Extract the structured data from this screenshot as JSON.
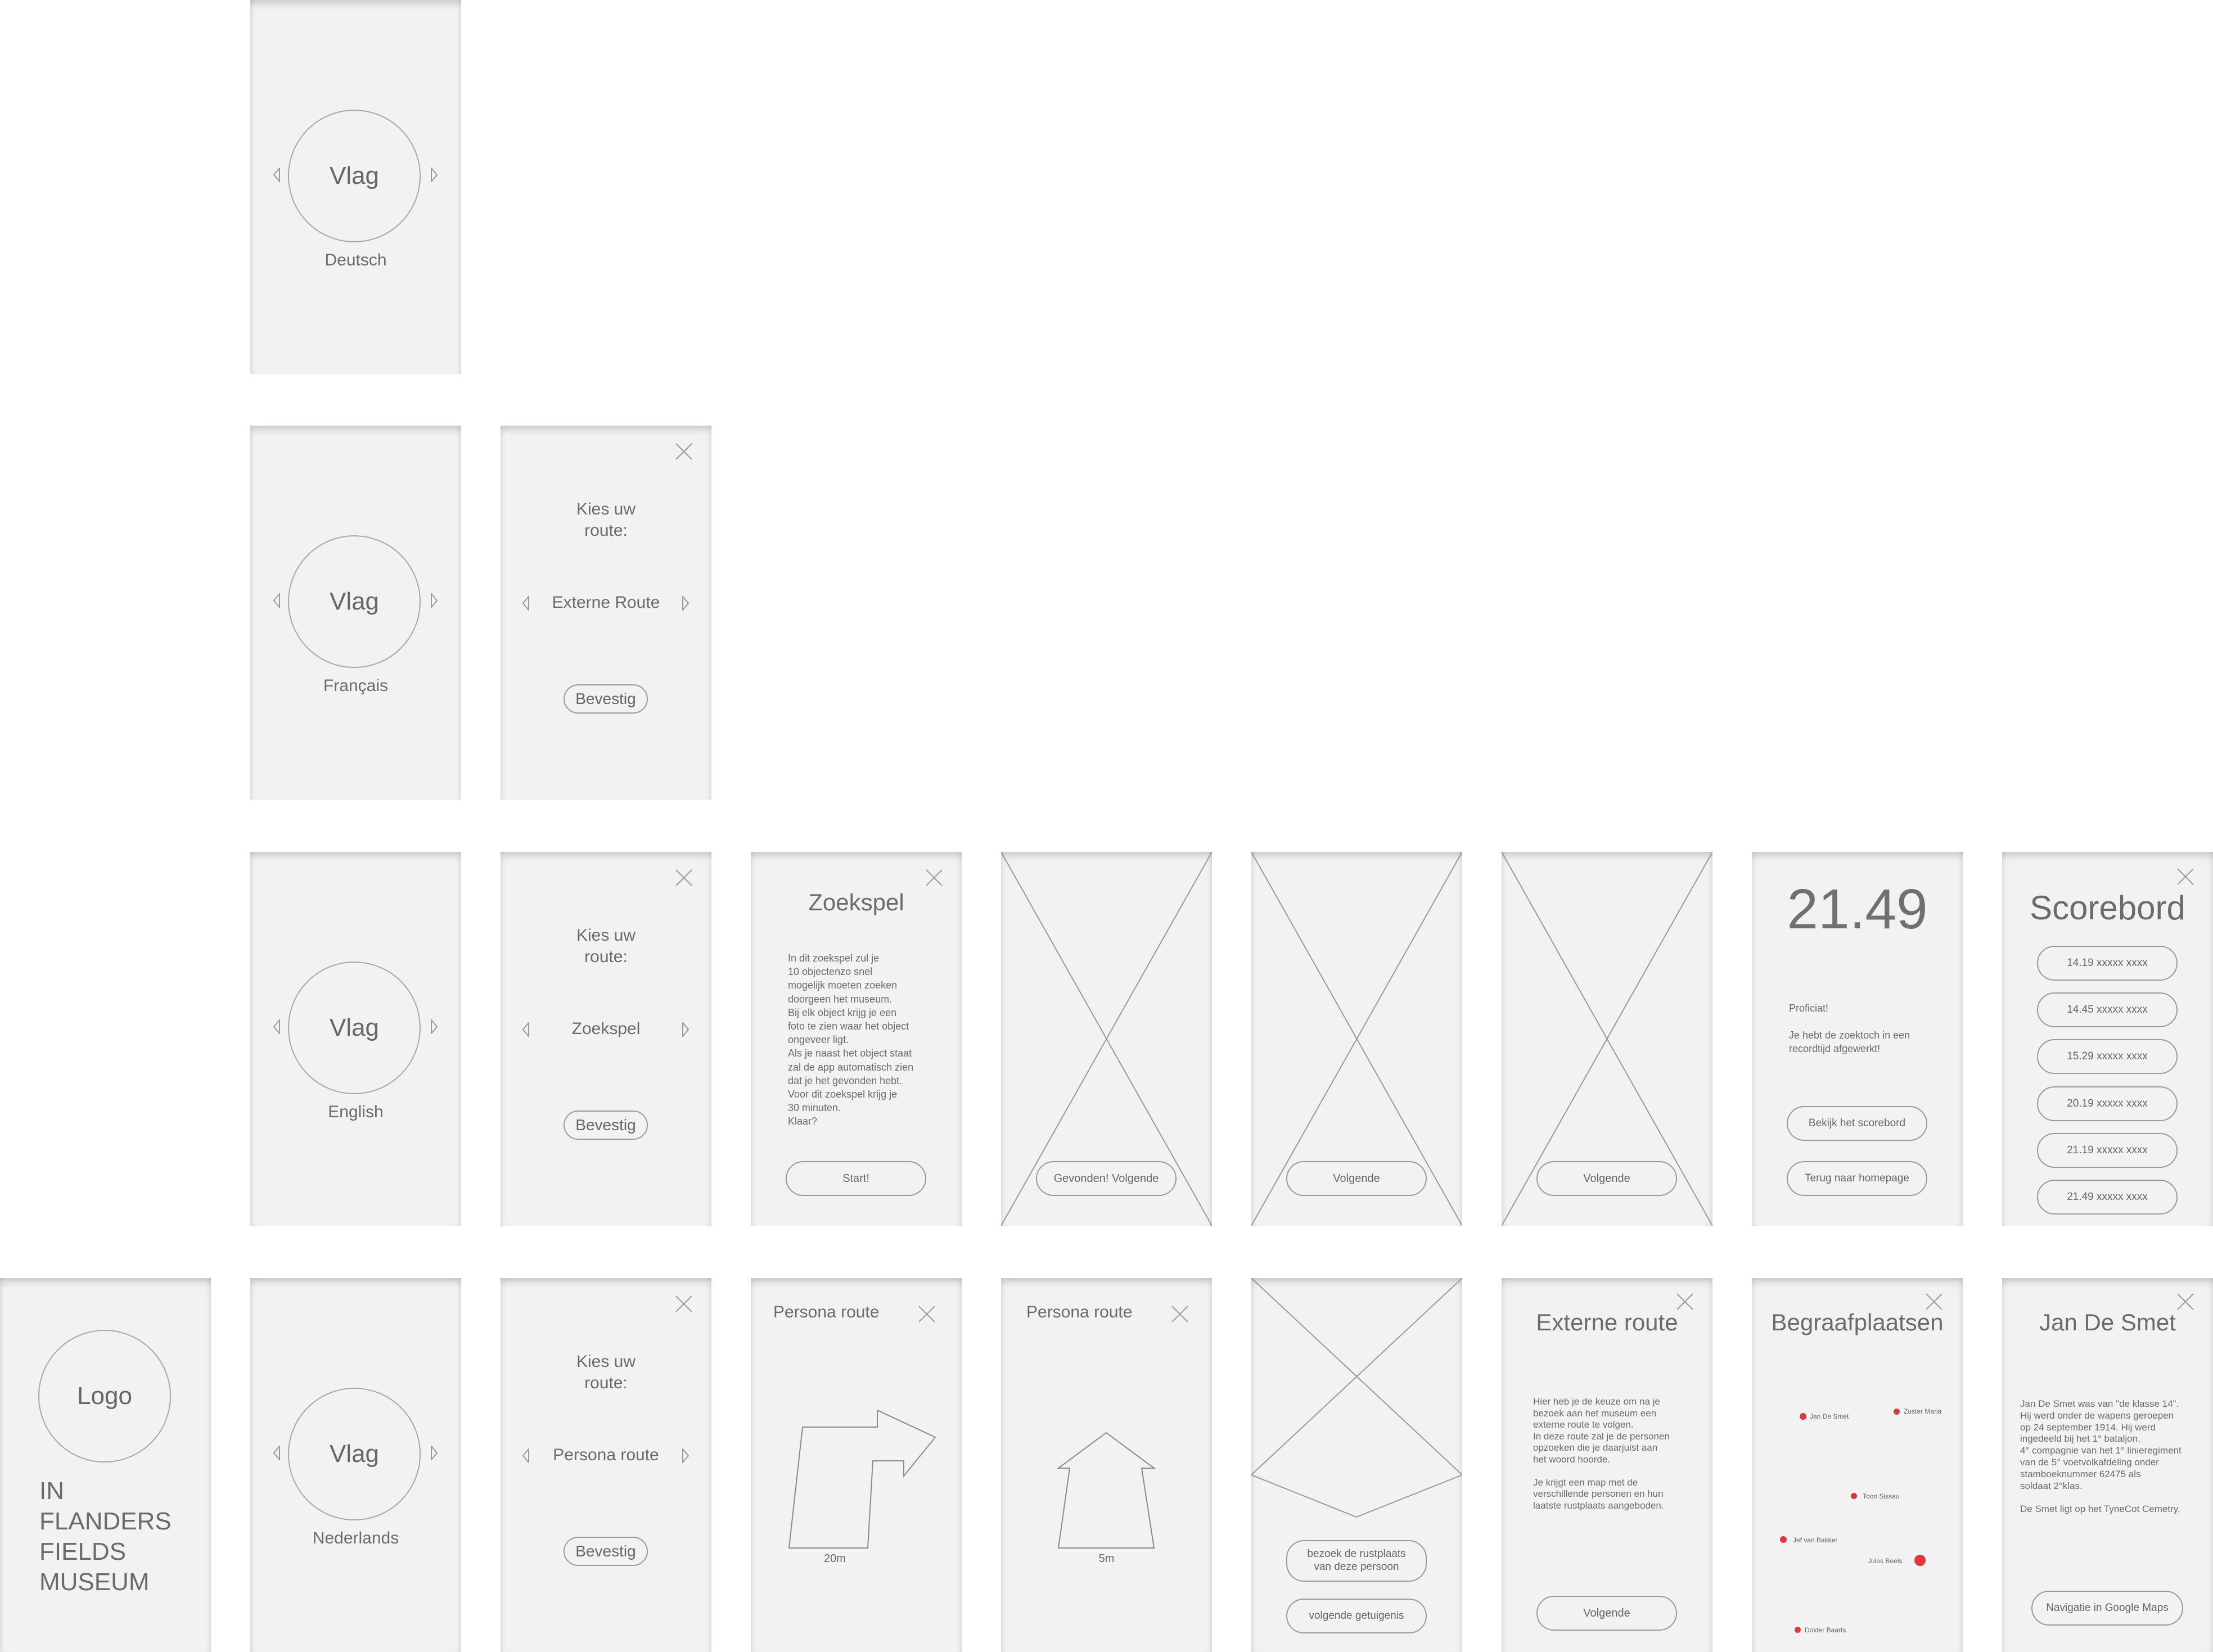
{
  "languages": [
    {
      "circle": "Vlag",
      "label": "Deutsch"
    },
    {
      "circle": "Vlag",
      "label": "Français"
    },
    {
      "circle": "Vlag",
      "label": "English"
    },
    {
      "circle": "Vlag",
      "label": "Nederlands"
    }
  ],
  "route_picker": {
    "title": "Kies uw\nroute:",
    "confirm": "Bevestig",
    "options": [
      "Externe Route",
      "Zoekspel",
      "Persona route"
    ]
  },
  "home": {
    "logo": "Logo",
    "museum_name": "IN\nFLANDERS\nFIELDS\nMUSEUM"
  },
  "zoekspel": {
    "title": "Zoekspel",
    "body": "In dit zoekspel zul je\n10 objectenzo snel\nmogelijk moeten zoeken\ndoorgeen het museum.\nBij elk object krijg je een\nfoto te zien waar het object\nongeveer ligt.\nAls je naast het object staat\nzal de app automatisch zien\ndat je het gevonden hebt.\nVoor dit zoekspel krijg je\n30 minuten.\nKlaar?",
    "start": "Start!"
  },
  "placeholders": {
    "found_next": "Gevonden! Volgende",
    "next_1": "Volgende",
    "next_2": "Volgende"
  },
  "result": {
    "time": "21.49",
    "congrats": "Proficiat!",
    "message": "Je hebt de zoektoch in een\nrecordtijd afgewerkt!",
    "view_scoreboard": "Bekijk het scorebord",
    "back_home": "Terug naar homepage"
  },
  "scoreboard": {
    "title": "Scorebord",
    "entries": [
      "14.19 xxxxx xxxx",
      "14.45 xxxxx xxxx",
      "15.29 xxxxx xxxx",
      "20.19 xxxxx xxxx",
      "21.19 xxxxx xxxx",
      "21.49 xxxxx xxxx"
    ]
  },
  "persona_route": {
    "title": "Persona route",
    "distance_1": "20m",
    "distance_2": "5m"
  },
  "persona_witness": {
    "visit": "bezoek de rustplaats\nvan deze persoon",
    "next_witness": "volgende getuigenis"
  },
  "externe_route": {
    "title": "Externe route",
    "body": "Hier heb je de keuze om na je\nbezoek aan het museum een\nexterne route te volgen.\nIn deze route zal je de personen\nopzoeken die je daarjuist aan\nhet woord hoorde.\n\nJe krijgt een map met de\nverschillende personen en hun\nlaatste rustplaats aangeboden.",
    "next": "Volgende"
  },
  "begraafplaatsen": {
    "title": "Begraafplaatsen",
    "markers": [
      "Jan De Smet",
      "Zuster Maria",
      "Toon Sissau",
      "Jef van Bakker",
      "Jules Boels",
      "Dokter Baarts"
    ],
    "marker_color": "#e0363c"
  },
  "person": {
    "title": "Jan De Smet",
    "body": "Jan De Smet was van \"de klasse 14\".\nHij werd onder de wapens geroepen\nop 24 september 1914. Hij werd\ningedeeld bij het 1° bataljon,\n4° compagnie van het 1° linieregiment\nvan de 5° voetvolkafdeling onder\nstamboeknummer 62475 als\nsoldaat 2°klas.\n\nDe Smet ligt op het TyneCot Cemetry.",
    "nav": "Navigatie in Google Maps"
  }
}
